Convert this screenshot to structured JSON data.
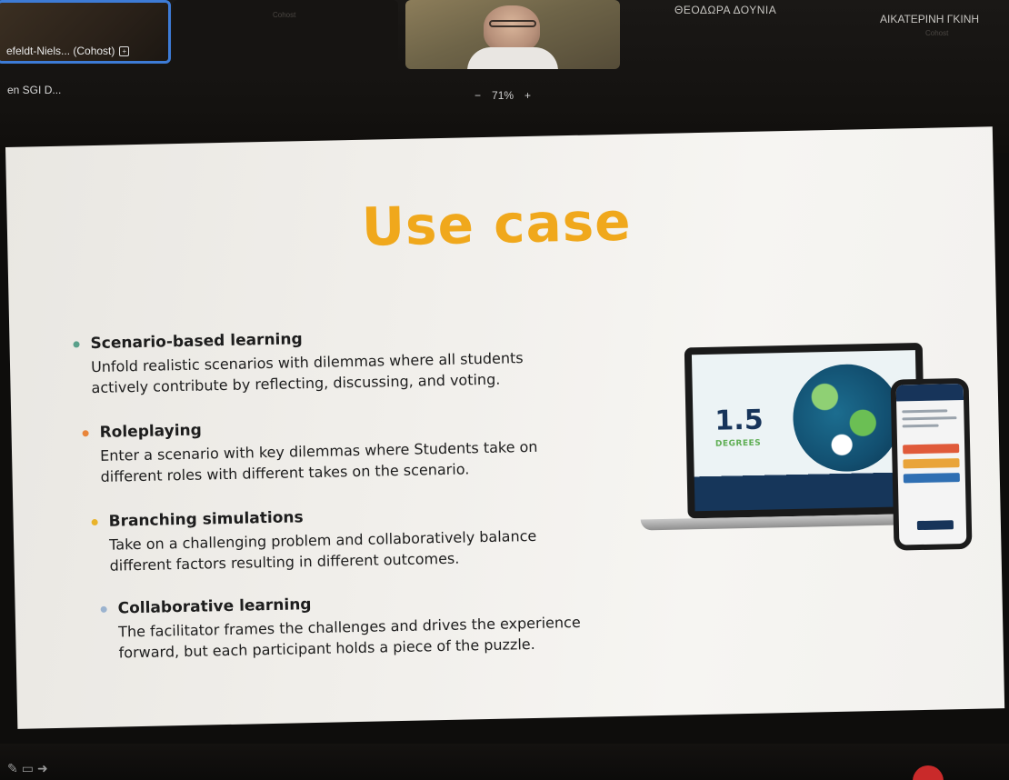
{
  "participants": {
    "left_tile_name": "efeldt-Niels... (Cohost)",
    "left_tile_badge": "+",
    "left_label": "en SGI D...",
    "mid_tile_sub": "Cohost",
    "doynia_name": "ΘΕΟΔΩΡΑ ΔΟΥΝΙΑ",
    "gkini_name": "ΑΙΚΑΤΕΡΙΝΗ ΓΚΙΝΗ",
    "gkini_sub": "Cohost"
  },
  "zoom": {
    "minus": "−",
    "value": "71%",
    "plus": "+"
  },
  "slide": {
    "title": "Use case",
    "items": [
      {
        "title": "Scenario-based learning",
        "desc": "Unfold realistic scenarios with dilemmas where all students actively contribute by reflecting, discussing, and voting.",
        "dot_color": "#5aa08a"
      },
      {
        "title": "Roleplaying",
        "desc": "Enter a scenario with key dilemmas where Students take on different roles with different takes on the scenario.",
        "dot_color": "#e8853a"
      },
      {
        "title": "Branching simulations",
        "desc": "Take on a challenging problem and collaboratively balance different factors resulting in different outcomes.",
        "dot_color": "#e9b32a"
      },
      {
        "title": "Collaborative learning",
        "desc": "The facilitator frames the challenges and drives the experience forward, but each participant holds a piece of the puzzle.",
        "dot_color": "#9bb3cf"
      }
    ],
    "device": {
      "big_number": "1.5",
      "degrees_label": "DEGREES"
    }
  },
  "colors": {
    "title": "#f0a81c",
    "active_speaker_border": "#3d7bd6"
  },
  "toolbar": {
    "icons": [
      "pencil-icon",
      "screen-icon",
      "arrow-icon"
    ]
  }
}
